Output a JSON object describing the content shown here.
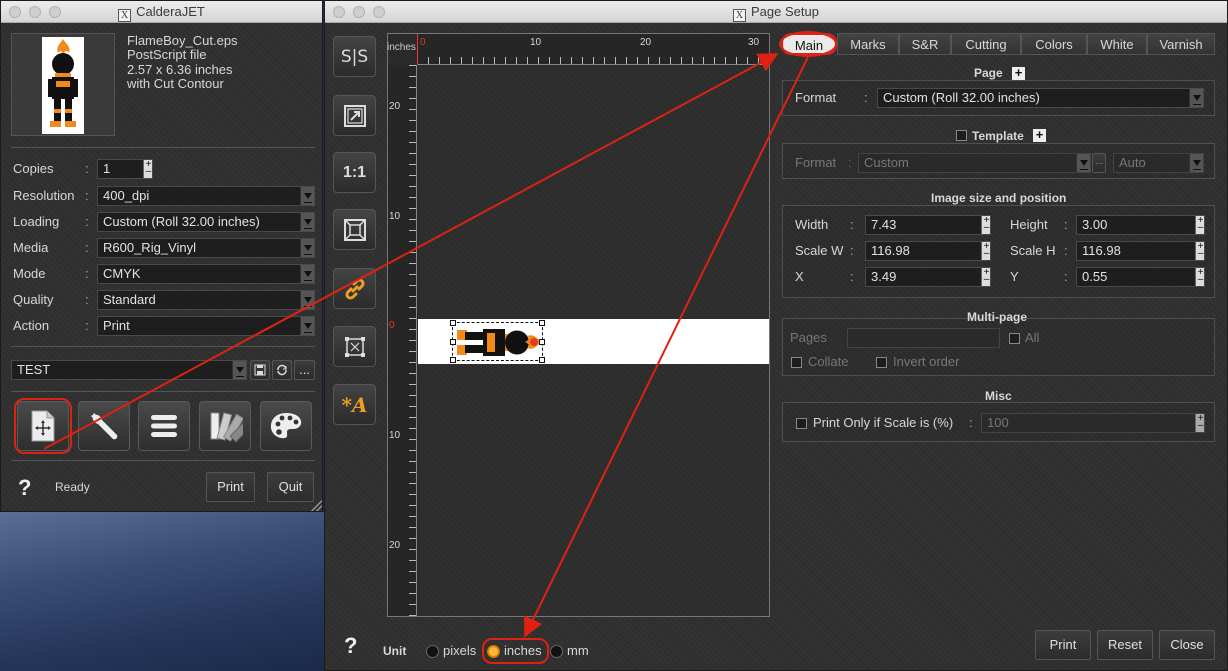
{
  "left_window": {
    "title": "CalderaJET",
    "file": {
      "name": "FlameBoy_Cut.eps",
      "type": "PostScript file",
      "size": "2.57 x 6.36 inches",
      "contour": "with Cut Contour"
    },
    "settings": {
      "copies_label": "Copies",
      "copies_value": "1",
      "resolution_label": "Resolution",
      "resolution_value": "400_dpi",
      "loading_label": "Loading",
      "loading_value": "Custom (Roll 32.00 inches)",
      "media_label": "Media",
      "media_value": "R600_Rig_Vinyl",
      "mode_label": "Mode",
      "mode_value": "CMYK",
      "quality_label": "Quality",
      "quality_value": "Standard",
      "action_label": "Action",
      "action_value": "Print"
    },
    "preset_value": "TEST",
    "preset_more": "...",
    "status": "Ready",
    "help": "?",
    "print_label": "Print",
    "quit_label": "Quit"
  },
  "page_setup": {
    "title": "Page Setup",
    "tools": {
      "sync_label": "S|S",
      "one_to_one_label": "1:1",
      "auto_text_label": "*A"
    },
    "ruler": {
      "unit_label": "inches",
      "h_ticks": [
        "0",
        "10",
        "20",
        "30"
      ],
      "v_ticks": [
        "20",
        "10",
        "0",
        "10",
        "20"
      ]
    },
    "tabs": [
      "Main",
      "Marks",
      "S&R",
      "Cutting",
      "Colors",
      "White",
      "Varnish"
    ],
    "page_section": {
      "title": "Page",
      "format_label": "Format",
      "format_value": "Custom (Roll 32.00 inches)"
    },
    "template_section": {
      "title": "Template",
      "format_label": "Format",
      "format_value": "Custom",
      "more": "...",
      "auto_value": "Auto"
    },
    "image_section": {
      "title": "Image size and position",
      "width_label": "Width",
      "width_value": "7.43",
      "height_label": "Height",
      "height_value": "3.00",
      "scalew_label": "Scale W",
      "scalew_value": "116.98",
      "scaleh_label": "Scale H",
      "scaleh_value": "116.98",
      "x_label": "X",
      "x_value": "3.49",
      "y_label": "Y",
      "y_value": "0.55"
    },
    "multipage_section": {
      "title": "Multi-page",
      "pages_label": "Pages",
      "all_label": "All",
      "collate_label": "Collate",
      "invert_label": "Invert order"
    },
    "misc_section": {
      "title": "Misc",
      "print_only_label": "Print Only if Scale is (%)",
      "scale_value": "100"
    },
    "unit_bar": {
      "help": "?",
      "unit_label": "Unit",
      "pixels_label": "pixels",
      "inches_label": "inches",
      "mm_label": "mm"
    },
    "buttons": {
      "print_label": "Print",
      "reset_label": "Reset",
      "close_label": "Close"
    }
  },
  "colors": {
    "annotation_red": "#dd2211",
    "accent_orange": "#f0a020",
    "panel": "#2f2f2f"
  }
}
